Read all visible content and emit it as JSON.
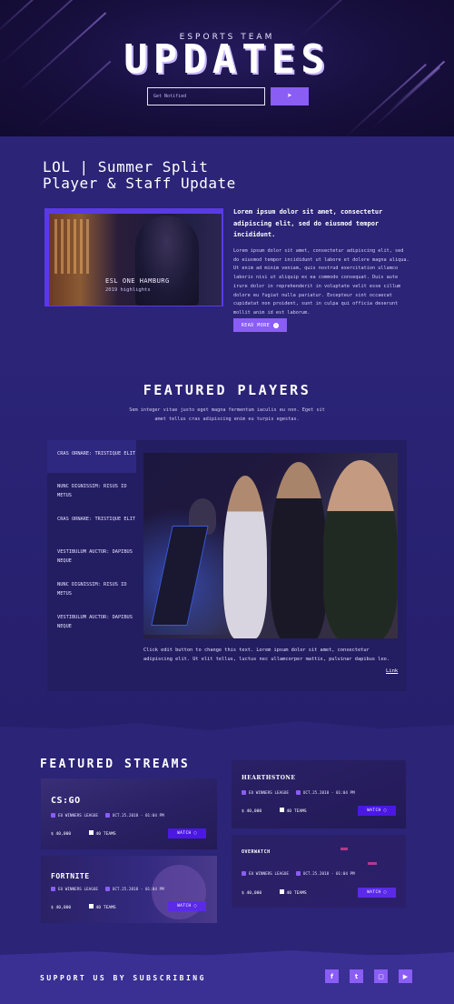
{
  "hero": {
    "kicker": "ESPORTS TEAM",
    "title": "UPDATES",
    "input_placeholder": "Get Notified",
    "send_icon": "paper-plane-icon"
  },
  "news": {
    "title": "LOL | Summer Split\nPlayer & Staff Update",
    "image_caption_title": "ESL ONE HAMBURG",
    "image_caption_sub": "2019 highlights",
    "lead": "Lorem ipsum dolor sit amet, consectetur adipiscing elit, sed do eiusmod tempor incididunt.",
    "body": "Lorem ipsum dolor sit amet, consectetur adipiscing elit, sed do eiusmod tempor incididunt ut labore et dolore magna aliqua. Ut enim ad minim veniam, quis nostrud exercitation ullamco laboris nisi ut aliquip ex ea commodo consequat. Duis aute irure dolor in reprehenderit in voluptate velit esse cillum dolore eu fugiat nulla pariatur. Excepteur sint occaecat cupidatat non proident, sunt in culpa qui officia deserunt mollit anim id est laborum.",
    "read_more": "READ MORE"
  },
  "players": {
    "title": "FEATURED PLAYERS",
    "subtitle": "Sem integer vitae justo eget magna fermentum iaculis eu non. Eget sit amet tellus cras adipiscing enim eu turpis egestas.",
    "items": [
      "CRAS ORNARE: TRISTIQUE ELIT",
      "NUNC DIGNISSIM: RISUS ID METUS",
      "CRAS ORNARE: TRISTIQUE ELIT",
      "VESTIBULUM AUCTOR: DAPIBUS NEQUE",
      "NUNC DIGNISSIM: RISUS ID METUS",
      "VESTIBULUM AUCTOR: DAPIBUS NEQUE"
    ],
    "caption": "Click edit button to change this text. Lorem ipsum dolor sit amet, consectetur adipiscing elit. Ut elit tellus, luctus nec ullamcorper mattis, pulvinar dapibus leo.",
    "link": "Link"
  },
  "streams": {
    "title": "FEATURED STREAMS",
    "cards": [
      {
        "logo": "CS:GO",
        "league": "EU WINNERS LEAGUE",
        "date": "OCT.25.2018 - 01:04 PM",
        "prize": "$ 40,000",
        "teams": "40 TEAMS",
        "watch": "WATCH"
      },
      {
        "logo": "FORTNITE",
        "league": "EU WINNERS LEAGUE",
        "date": "OCT.25.2018 - 01:04 PM",
        "prize": "$ 40,000",
        "teams": "40 TEAMS",
        "watch": "WATCH"
      },
      {
        "logo": "HEARTHSTONE",
        "league": "EU WINNERS LEAGUE",
        "date": "OCT.25.2018 - 01:04 PM",
        "prize": "$ 40,000",
        "teams": "40 TEAMS",
        "watch": "WATCH"
      },
      {
        "logo": "OVERWATCH",
        "league": "EU WINNERS LEAGUE",
        "date": "OCT.25.2018 - 01:04 PM",
        "prize": "$ 40,000",
        "teams": "40 TEAMS",
        "watch": "WATCH"
      }
    ]
  },
  "footer": {
    "title": "SUPPORT US BY SUBSCRIBING",
    "social": [
      "f",
      "t",
      "tw",
      "yt"
    ]
  },
  "colors": {
    "accent": "#8a5df5",
    "background": "#2b2477",
    "hero": "#170f3d",
    "watch_button": "#4b18e3"
  }
}
